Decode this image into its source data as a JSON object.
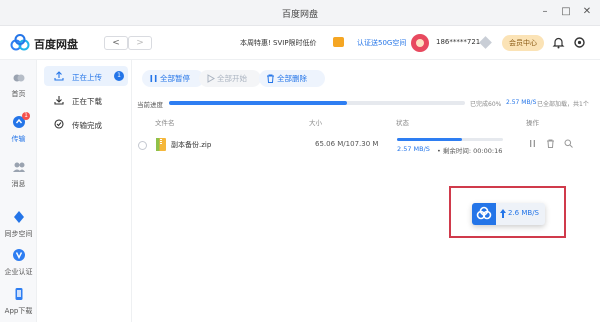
{
  "window": {
    "title": "百度网盘"
  },
  "header": {
    "brand": "百度网盘",
    "back_label": "<",
    "forward_label": ">",
    "promo_text": "本周特惠! SVIP限时低价",
    "svip_link": "认证送50G空间",
    "username": "186*****721",
    "vip_button": "会员中心"
  },
  "rail": {
    "items": [
      {
        "label": "首页",
        "icon": "home-icon"
      },
      {
        "label": "传输",
        "icon": "transfer-icon",
        "badge": "1"
      },
      {
        "label": "消息",
        "icon": "people-icon"
      },
      {
        "label": "同步空间",
        "icon": "sync-icon"
      },
      {
        "label": "企业认证",
        "icon": "verify-icon"
      },
      {
        "label": "App下载",
        "icon": "phone-icon"
      }
    ]
  },
  "subnav": {
    "items": [
      {
        "label": "正在上传",
        "count": "1"
      },
      {
        "label": "正在下载"
      },
      {
        "label": "传输完成"
      }
    ]
  },
  "toolbar": {
    "pause_all": "全部暂停",
    "start_all": "全部开始",
    "delete_all": "全部删除"
  },
  "overall": {
    "label": "当前进度",
    "percent": 60,
    "status_text": "已完成60%",
    "speed": "2.57 MB/S",
    "summary": "已全部加载，共1个"
  },
  "table": {
    "headers": [
      "文件名",
      "大小",
      "状态",
      "操作"
    ],
    "rows": [
      {
        "name": "副本备份.zip",
        "size": "65.06 M/107.30 M",
        "progress": 61,
        "speed": "2.57 MB/S",
        "remaining": "• 剩余时间: 00:00:16"
      }
    ]
  },
  "float_window": {
    "rate": "2.6 MB/S"
  },
  "colors": {
    "accent": "#2475e8",
    "callout": "#d03a4b",
    "vip": "#fbe3b6"
  }
}
